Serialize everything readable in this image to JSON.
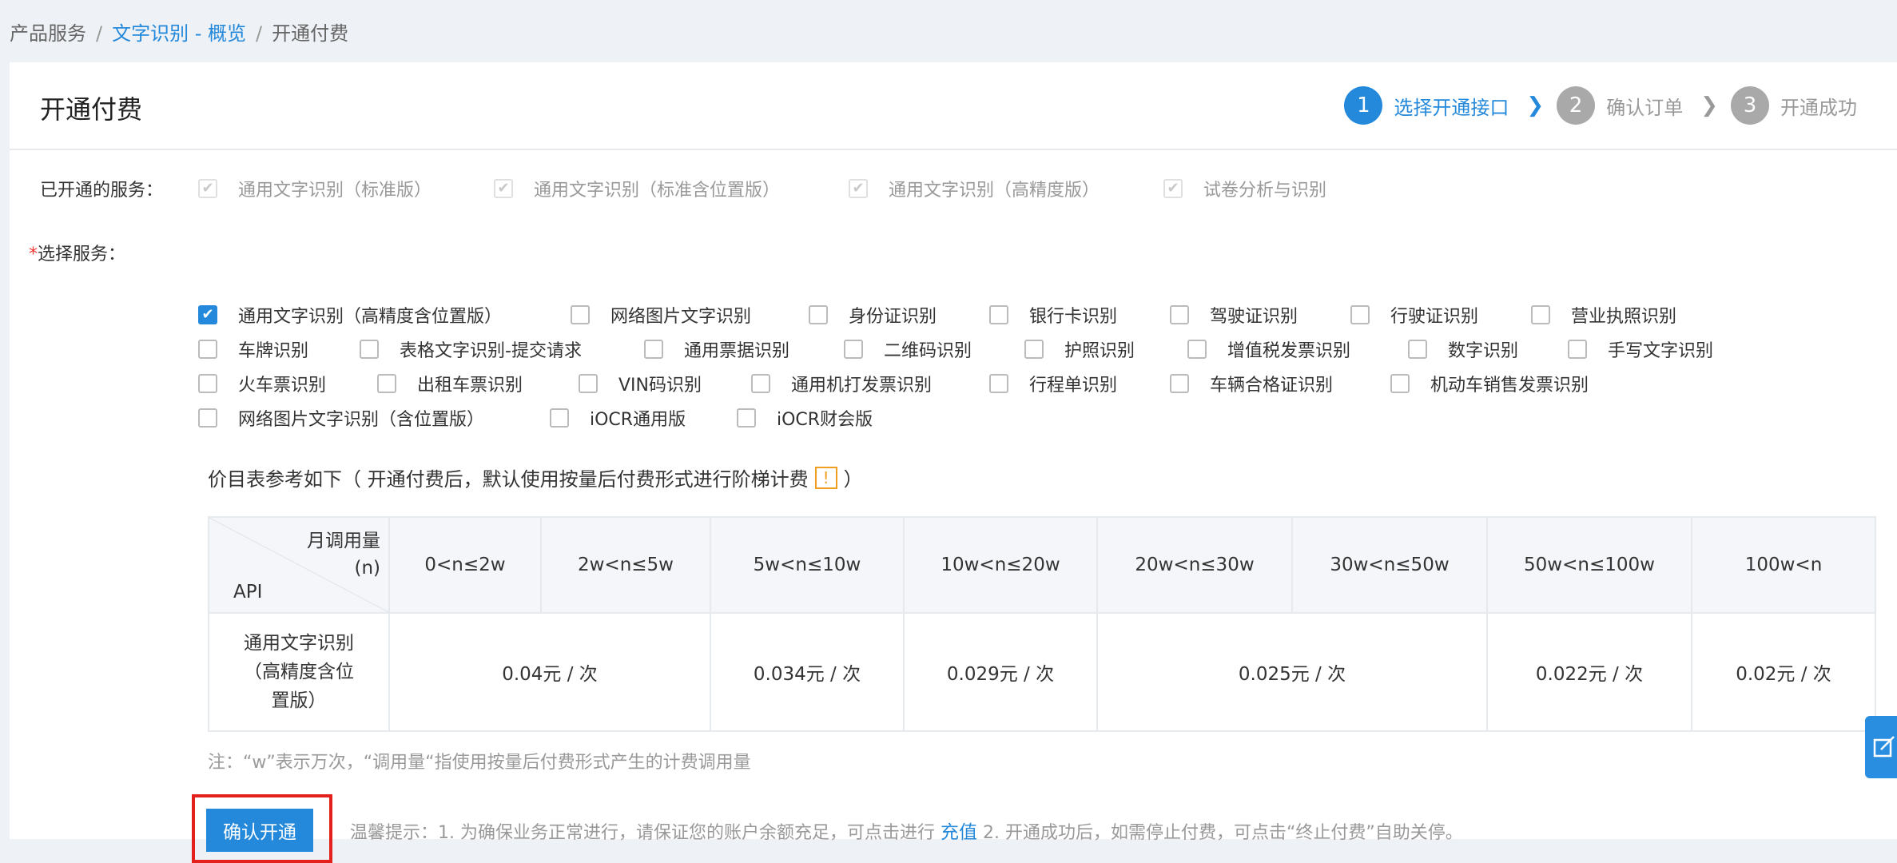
{
  "breadcrumb": {
    "root": "产品服务",
    "link": "文字识别 - 概览",
    "current": "开通付费",
    "sep": "/"
  },
  "page_title": "开通付费",
  "steps": [
    {
      "num": "1",
      "label": "选择开通接口"
    },
    {
      "num": "2",
      "label": "确认订单"
    },
    {
      "num": "3",
      "label": "开通成功"
    }
  ],
  "opened": {
    "label": "已开通的服务：",
    "items": [
      "通用文字识别（标准版）",
      "通用文字识别（标准含位置版）",
      "通用文字识别（高精度版）",
      "试卷分析与识别"
    ]
  },
  "select": {
    "required": "*",
    "label": "选择服务：",
    "row1": [
      "通用文字识别（高精度含位置版）",
      "网络图片文字识别",
      "身份证识别",
      "银行卡识别",
      "驾驶证识别",
      "行驶证识别",
      "营业执照识别"
    ],
    "row2": [
      "车牌识别",
      "表格文字识别-提交请求",
      "通用票据识别",
      "二维码识别",
      "护照识别",
      "增值税发票识别",
      "数字识别",
      "手写文字识别"
    ],
    "row3": [
      "火车票识别",
      "出租车票识别",
      "VIN码识别",
      "通用机打发票识别",
      "行程单识别",
      "车辆合格证识别",
      "机动车销售发票识别"
    ],
    "row4": [
      "网络图片文字识别（含位置版）",
      "iOCR通用版",
      "iOCR财会版"
    ]
  },
  "price_note": {
    "before": "价目表参考如下（ 开通付费后，默认使用按量后付费形式进行阶梯计费",
    "warn": "!",
    "after": "）"
  },
  "table": {
    "corner_top1": "月调用量",
    "corner_top2": "(n)",
    "corner_bottom": "API",
    "headers": [
      "0<n≤2w",
      "2w<n≤5w",
      "5w<n≤10w",
      "10w<n≤20w",
      "20w<n≤30w",
      "30w<n≤50w",
      "50w<n≤100w",
      "100w<n"
    ],
    "row_api": [
      "通用文字识别",
      "（高精度含位",
      "置版）"
    ],
    "prices": [
      "0.04元 / 次",
      "0.034元 / 次",
      "0.029元 / 次",
      "0.025元 / 次",
      "0.022元 / 次",
      "0.02元 / 次"
    ]
  },
  "footnote": "注：“w”表示万次，“调用量“指使用按量后付费形式产生的计费调用量",
  "confirm_label": "确认开通",
  "tip": {
    "before": "温馨提示：1. 为确保业务正常进行，请保证您的账户余额充足，可点击进行 ",
    "link": "充值",
    "after": " 2. 开通成功后，如需停止付费，可点击“终止付费”自助关停。"
  },
  "colors": {
    "primary": "#2489db",
    "highlight_border": "#e3201b",
    "warn": "#f0a020"
  }
}
